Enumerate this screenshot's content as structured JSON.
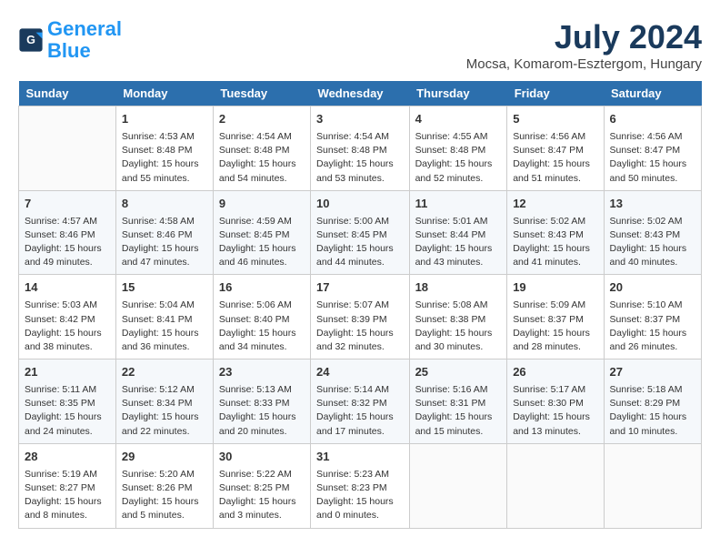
{
  "header": {
    "logo_line1": "General",
    "logo_line2": "Blue",
    "month": "July 2024",
    "location": "Mocsa, Komarom-Esztergom, Hungary"
  },
  "days_of_week": [
    "Sunday",
    "Monday",
    "Tuesday",
    "Wednesday",
    "Thursday",
    "Friday",
    "Saturday"
  ],
  "weeks": [
    [
      {
        "day": "",
        "info": ""
      },
      {
        "day": "1",
        "info": "Sunrise: 4:53 AM\nSunset: 8:48 PM\nDaylight: 15 hours\nand 55 minutes."
      },
      {
        "day": "2",
        "info": "Sunrise: 4:54 AM\nSunset: 8:48 PM\nDaylight: 15 hours\nand 54 minutes."
      },
      {
        "day": "3",
        "info": "Sunrise: 4:54 AM\nSunset: 8:48 PM\nDaylight: 15 hours\nand 53 minutes."
      },
      {
        "day": "4",
        "info": "Sunrise: 4:55 AM\nSunset: 8:48 PM\nDaylight: 15 hours\nand 52 minutes."
      },
      {
        "day": "5",
        "info": "Sunrise: 4:56 AM\nSunset: 8:47 PM\nDaylight: 15 hours\nand 51 minutes."
      },
      {
        "day": "6",
        "info": "Sunrise: 4:56 AM\nSunset: 8:47 PM\nDaylight: 15 hours\nand 50 minutes."
      }
    ],
    [
      {
        "day": "7",
        "info": "Sunrise: 4:57 AM\nSunset: 8:46 PM\nDaylight: 15 hours\nand 49 minutes."
      },
      {
        "day": "8",
        "info": "Sunrise: 4:58 AM\nSunset: 8:46 PM\nDaylight: 15 hours\nand 47 minutes."
      },
      {
        "day": "9",
        "info": "Sunrise: 4:59 AM\nSunset: 8:45 PM\nDaylight: 15 hours\nand 46 minutes."
      },
      {
        "day": "10",
        "info": "Sunrise: 5:00 AM\nSunset: 8:45 PM\nDaylight: 15 hours\nand 44 minutes."
      },
      {
        "day": "11",
        "info": "Sunrise: 5:01 AM\nSunset: 8:44 PM\nDaylight: 15 hours\nand 43 minutes."
      },
      {
        "day": "12",
        "info": "Sunrise: 5:02 AM\nSunset: 8:43 PM\nDaylight: 15 hours\nand 41 minutes."
      },
      {
        "day": "13",
        "info": "Sunrise: 5:02 AM\nSunset: 8:43 PM\nDaylight: 15 hours\nand 40 minutes."
      }
    ],
    [
      {
        "day": "14",
        "info": "Sunrise: 5:03 AM\nSunset: 8:42 PM\nDaylight: 15 hours\nand 38 minutes."
      },
      {
        "day": "15",
        "info": "Sunrise: 5:04 AM\nSunset: 8:41 PM\nDaylight: 15 hours\nand 36 minutes."
      },
      {
        "day": "16",
        "info": "Sunrise: 5:06 AM\nSunset: 8:40 PM\nDaylight: 15 hours\nand 34 minutes."
      },
      {
        "day": "17",
        "info": "Sunrise: 5:07 AM\nSunset: 8:39 PM\nDaylight: 15 hours\nand 32 minutes."
      },
      {
        "day": "18",
        "info": "Sunrise: 5:08 AM\nSunset: 8:38 PM\nDaylight: 15 hours\nand 30 minutes."
      },
      {
        "day": "19",
        "info": "Sunrise: 5:09 AM\nSunset: 8:37 PM\nDaylight: 15 hours\nand 28 minutes."
      },
      {
        "day": "20",
        "info": "Sunrise: 5:10 AM\nSunset: 8:37 PM\nDaylight: 15 hours\nand 26 minutes."
      }
    ],
    [
      {
        "day": "21",
        "info": "Sunrise: 5:11 AM\nSunset: 8:35 PM\nDaylight: 15 hours\nand 24 minutes."
      },
      {
        "day": "22",
        "info": "Sunrise: 5:12 AM\nSunset: 8:34 PM\nDaylight: 15 hours\nand 22 minutes."
      },
      {
        "day": "23",
        "info": "Sunrise: 5:13 AM\nSunset: 8:33 PM\nDaylight: 15 hours\nand 20 minutes."
      },
      {
        "day": "24",
        "info": "Sunrise: 5:14 AM\nSunset: 8:32 PM\nDaylight: 15 hours\nand 17 minutes."
      },
      {
        "day": "25",
        "info": "Sunrise: 5:16 AM\nSunset: 8:31 PM\nDaylight: 15 hours\nand 15 minutes."
      },
      {
        "day": "26",
        "info": "Sunrise: 5:17 AM\nSunset: 8:30 PM\nDaylight: 15 hours\nand 13 minutes."
      },
      {
        "day": "27",
        "info": "Sunrise: 5:18 AM\nSunset: 8:29 PM\nDaylight: 15 hours\nand 10 minutes."
      }
    ],
    [
      {
        "day": "28",
        "info": "Sunrise: 5:19 AM\nSunset: 8:27 PM\nDaylight: 15 hours\nand 8 minutes."
      },
      {
        "day": "29",
        "info": "Sunrise: 5:20 AM\nSunset: 8:26 PM\nDaylight: 15 hours\nand 5 minutes."
      },
      {
        "day": "30",
        "info": "Sunrise: 5:22 AM\nSunset: 8:25 PM\nDaylight: 15 hours\nand 3 minutes."
      },
      {
        "day": "31",
        "info": "Sunrise: 5:23 AM\nSunset: 8:23 PM\nDaylight: 15 hours\nand 0 minutes."
      },
      {
        "day": "",
        "info": ""
      },
      {
        "day": "",
        "info": ""
      },
      {
        "day": "",
        "info": ""
      }
    ]
  ]
}
